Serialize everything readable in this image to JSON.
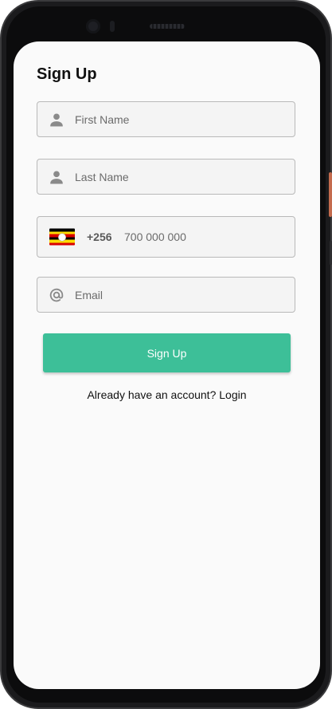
{
  "page": {
    "title": "Sign Up"
  },
  "form": {
    "first_name": {
      "placeholder": "First Name",
      "icon": "person-icon"
    },
    "last_name": {
      "placeholder": "Last Name",
      "icon": "person-icon"
    },
    "phone": {
      "country_flag": "uganda-flag-icon",
      "dial_code": "+256",
      "placeholder": "700 000 000"
    },
    "email": {
      "placeholder": "Email",
      "icon": "at-sign-icon"
    },
    "submit_label": "Sign Up",
    "login_prompt": "Already have an account? Login"
  },
  "colors": {
    "accent": "#3dbf98",
    "field_background": "#f4f4f4",
    "field_border": "#b9b9b9",
    "screen_background": "#fafafa"
  }
}
